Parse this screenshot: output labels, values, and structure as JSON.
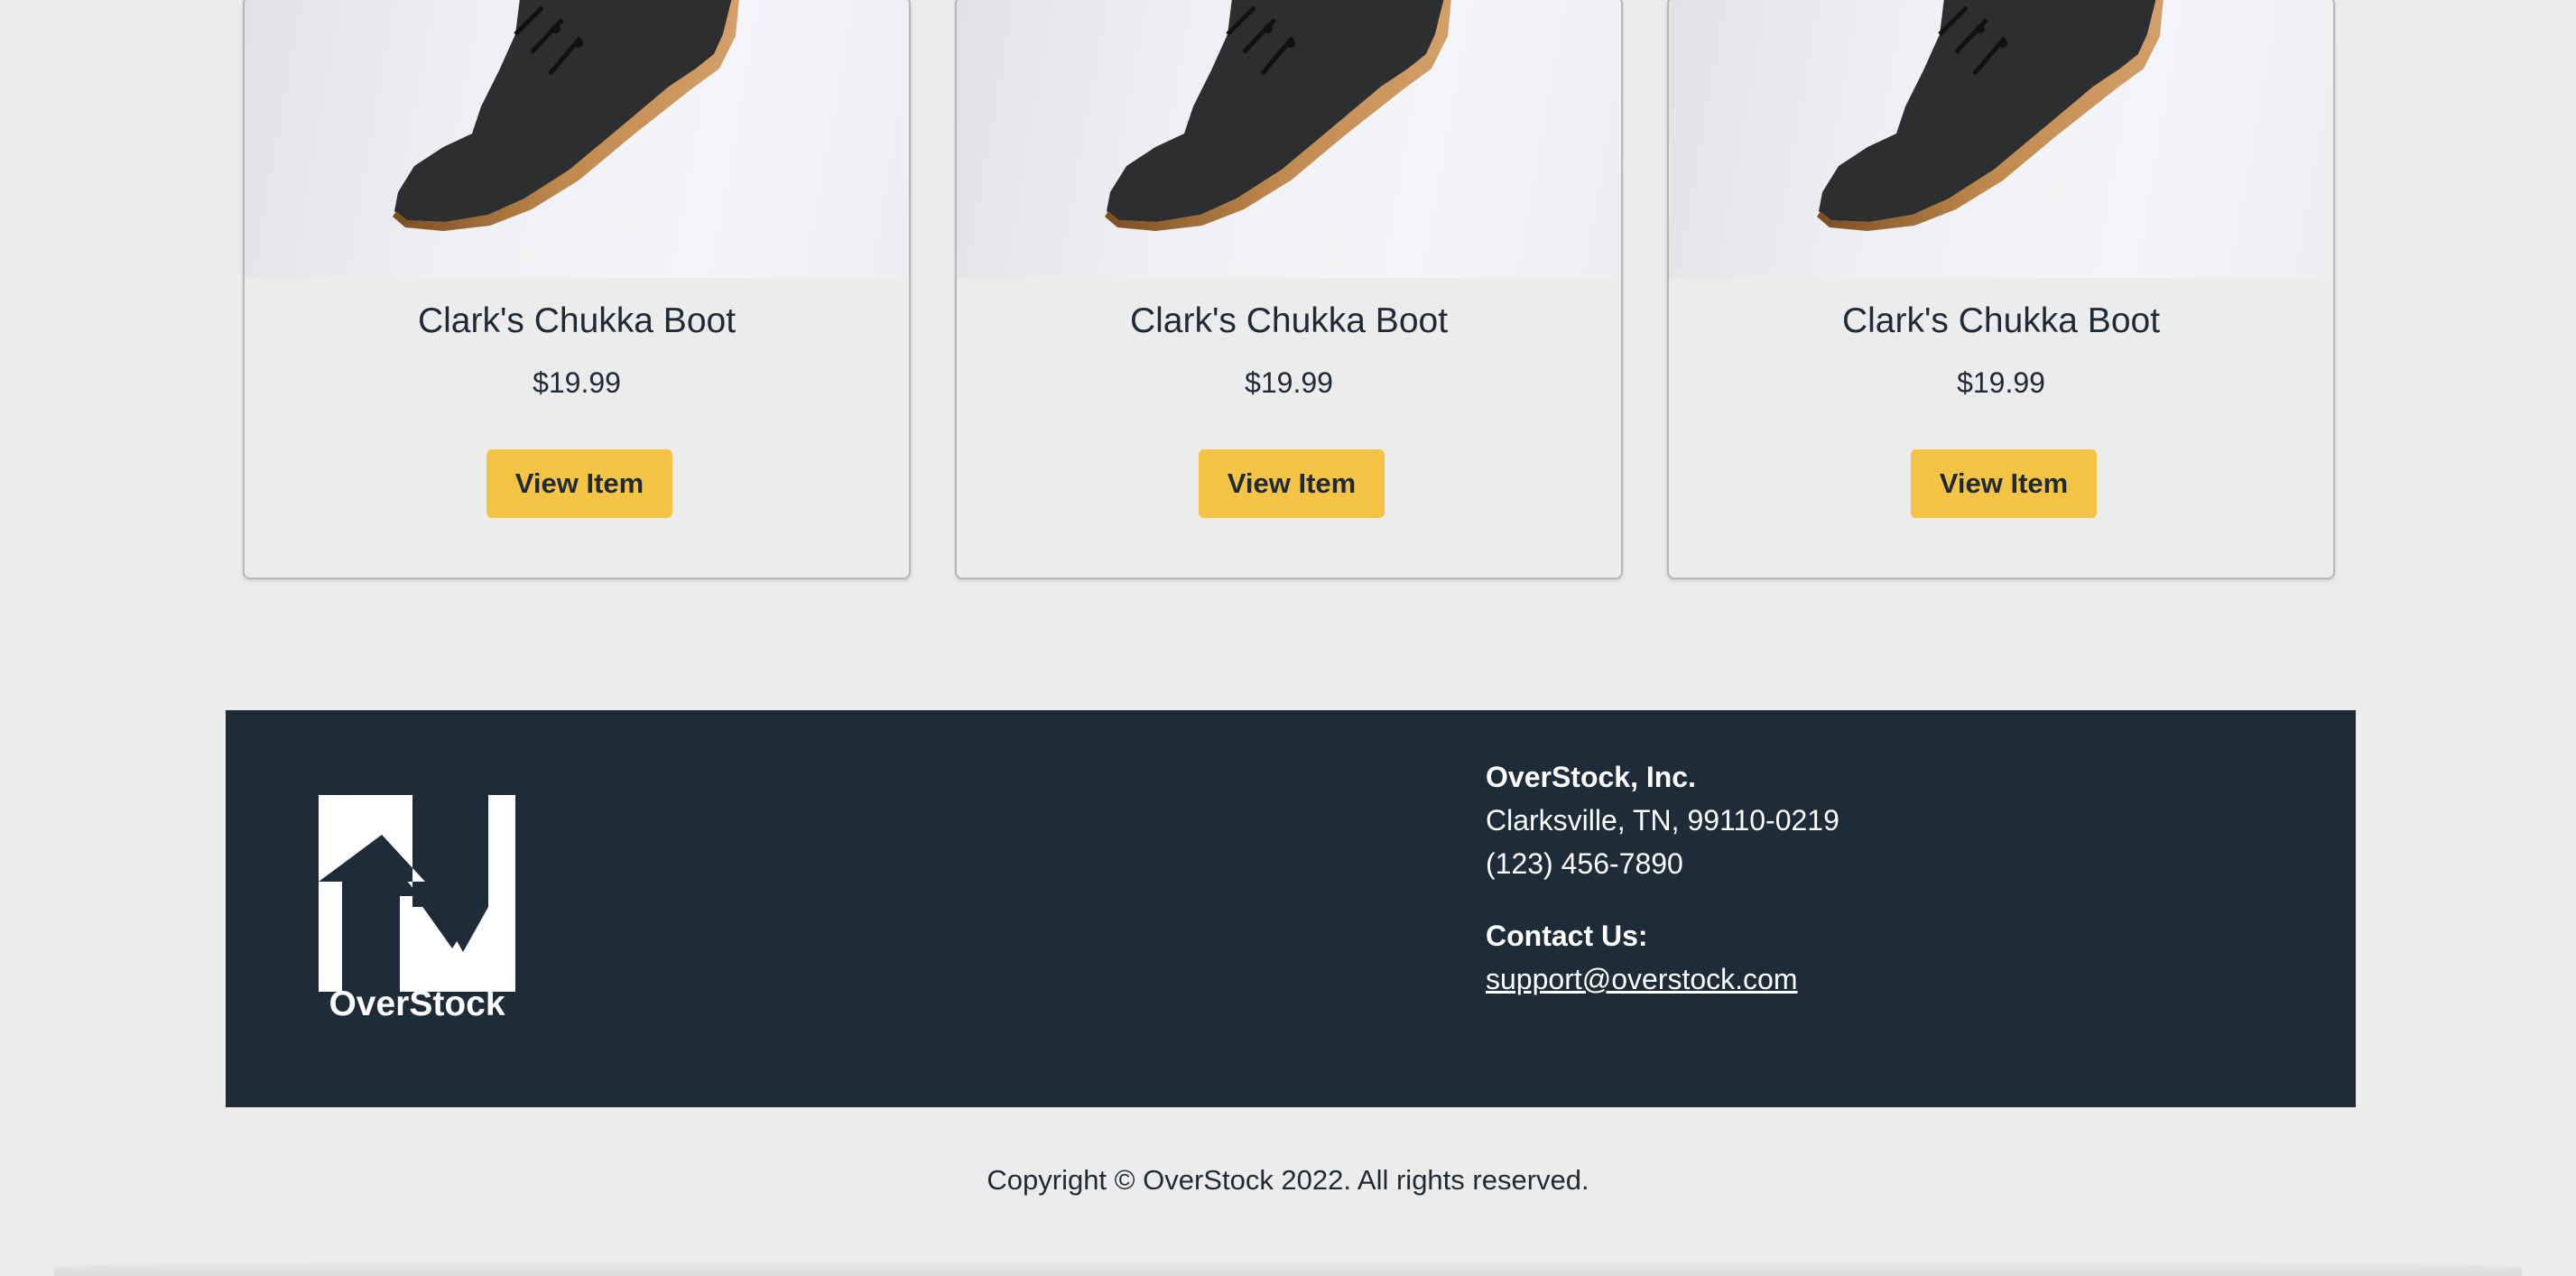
{
  "products": [
    {
      "name": "Clark's Chukka Boot",
      "price": "$19.99",
      "button_label": "View Item",
      "image_icon": "boot-image"
    },
    {
      "name": "Clark's Chukka Boot",
      "price": "$19.99",
      "button_label": "View Item",
      "image_icon": "boot-image"
    },
    {
      "name": "Clark's Chukka Boot",
      "price": "$19.99",
      "button_label": "View Item",
      "image_icon": "boot-image"
    }
  ],
  "footer": {
    "logo_text": "OverStock",
    "company_name": "OverStock, Inc.",
    "address": "Clarksville, TN, 99110-0219",
    "phone": "(123) 456-7890",
    "contact_heading": "Contact Us:",
    "email": "support@overstock.com"
  },
  "copyright": "Copyright © OverStock 2022. All rights reserved.",
  "colors": {
    "button": "#f6c445",
    "footer_bg": "#1e2b38",
    "page_bg": "#ececec"
  }
}
